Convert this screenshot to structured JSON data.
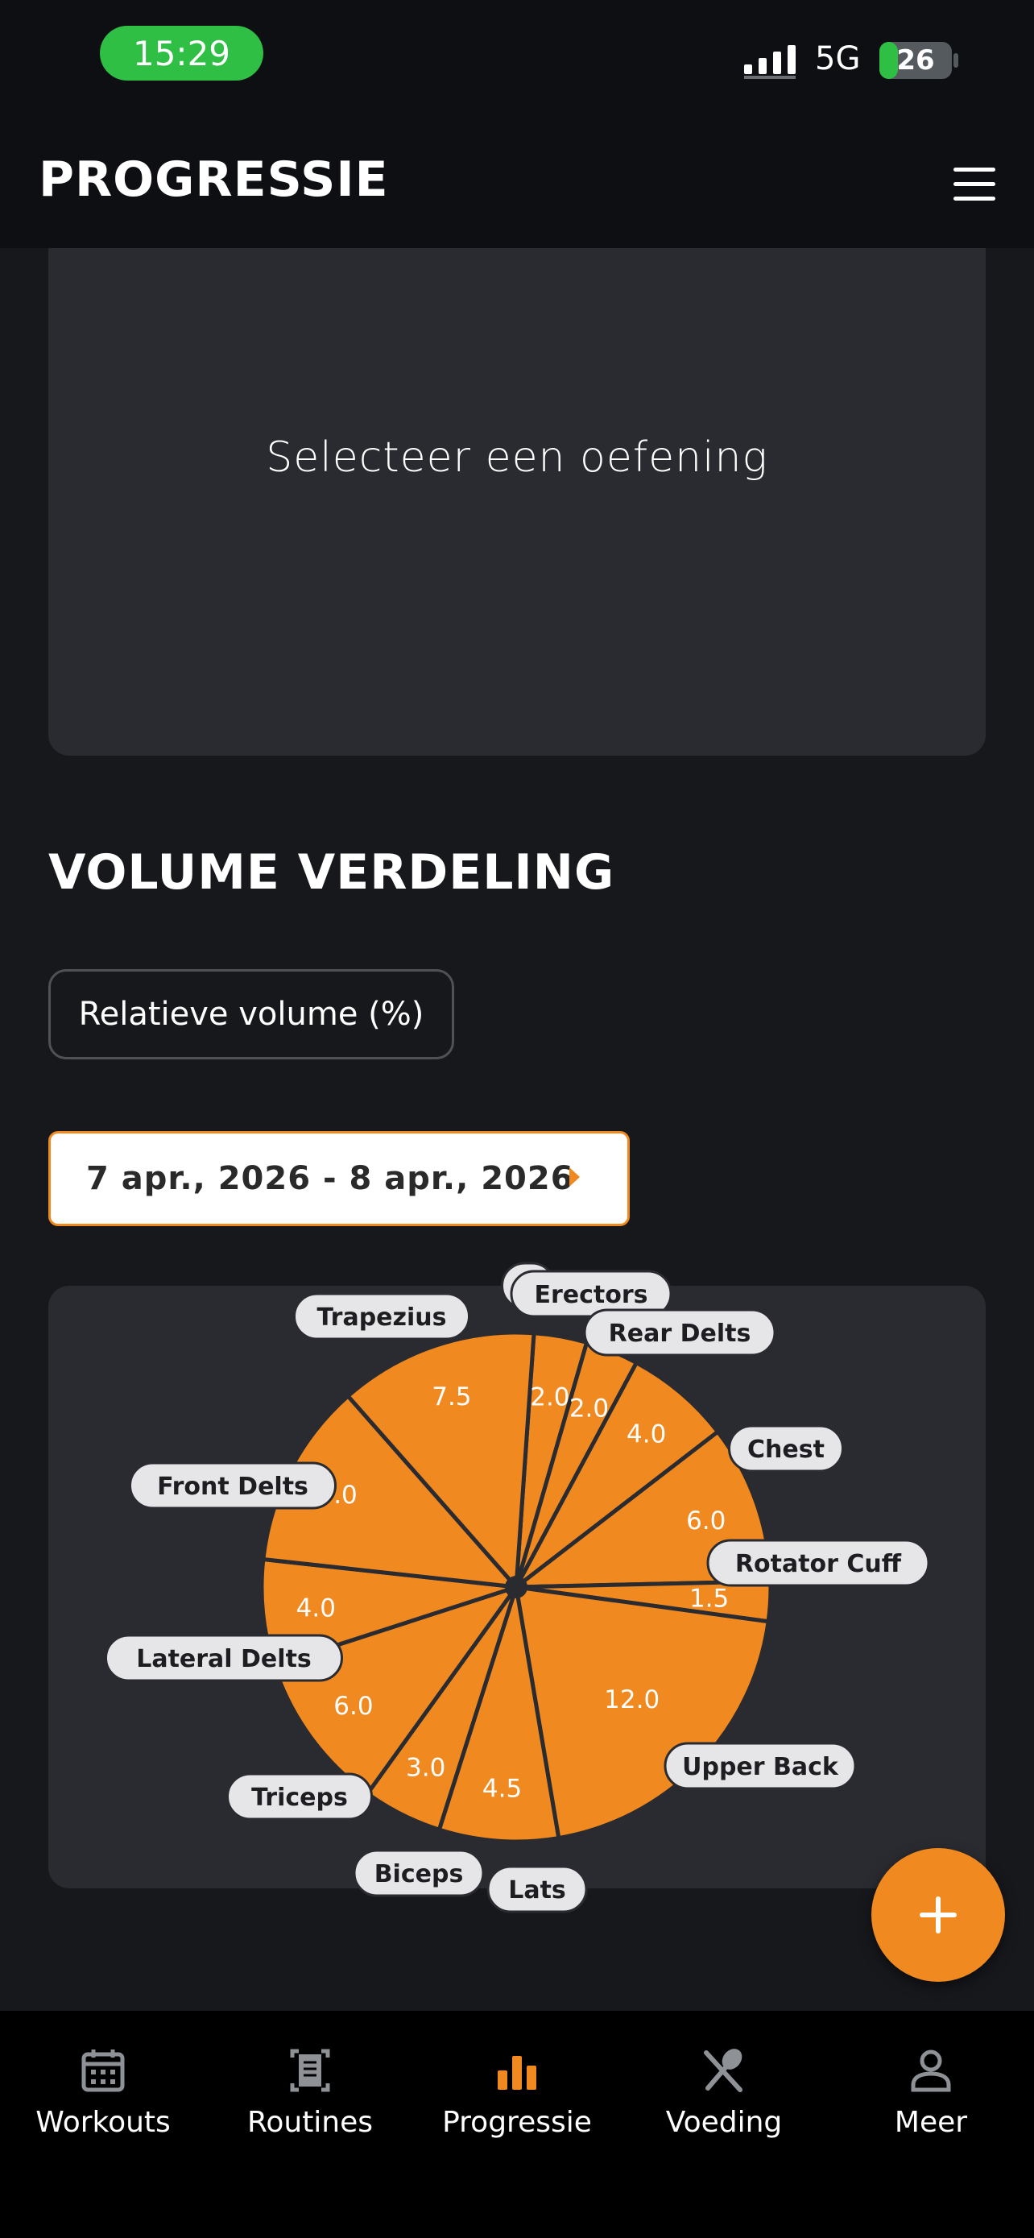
{
  "status_bar": {
    "time": "15:29",
    "network": "5G",
    "battery": "26",
    "battery_level": 0.26
  },
  "header": {
    "title": "PROGRESSIE",
    "menu_icon": "hamburger-menu-icon"
  },
  "exercise_chart": {
    "placeholder": "Selecteer een oefening"
  },
  "volume": {
    "title": "VOLUME VERDELING",
    "mode_button": "Relatieve volume (%)",
    "date_range": "7 apr., 2026 - 8 apr., 2026",
    "date_arrow_icon": "caret-right-icon"
  },
  "chart_data": {
    "type": "pie",
    "color": "#f0891f",
    "segments": [
      {
        "label": "Abs",
        "value": 2.0,
        "label_text": "A"
      },
      {
        "label": "Erectors",
        "value": 2.0
      },
      {
        "label": "Rear Delts",
        "value": 4.0
      },
      {
        "label": "Chest",
        "value": 6.0
      },
      {
        "label": "Rotator Cuff",
        "value": 1.5
      },
      {
        "label": "Upper Back",
        "value": 12.0
      },
      {
        "label": "Lats",
        "value": 4.5
      },
      {
        "label": "Biceps",
        "value": 3.0
      },
      {
        "label": "Triceps",
        "value": 6.0
      },
      {
        "label": "Lateral Delts",
        "value": 4.0
      },
      {
        "label": "Front Delts",
        "value": 7.0
      },
      {
        "label": "Trapezius",
        "value": 7.5
      }
    ]
  },
  "fab": {
    "icon": "plus-icon"
  },
  "tabs": [
    {
      "label": "Workouts",
      "icon": "calendar-icon",
      "active": false
    },
    {
      "label": "Routines",
      "icon": "clipboard-icon",
      "active": false
    },
    {
      "label": "Progressie",
      "icon": "bar-chart-icon",
      "active": true
    },
    {
      "label": "Voeding",
      "icon": "fork-spoon-icon",
      "active": false
    },
    {
      "label": "Meer",
      "icon": "person-icon",
      "active": false
    }
  ],
  "colors": {
    "accent": "#f0891f",
    "background": "#17181c",
    "card": "#2a2b30",
    "status_green": "#2fbf45"
  }
}
